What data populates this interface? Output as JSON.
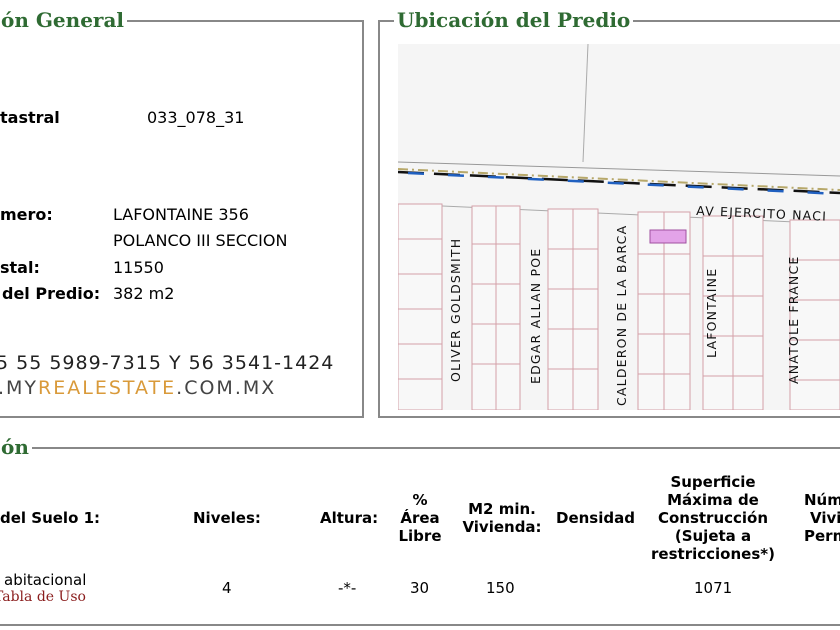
{
  "general": {
    "title": "ón General",
    "cuenta_label": "tastral",
    "cuenta_value": "033_078_31",
    "numero_label": "mero:",
    "direccion_line1": "LAFONTAINE 356",
    "direccion_line2": "POLANCO III SECCION",
    "cp_label": "stal:",
    "cp_value": "11550",
    "superficie_label": "del Predio:",
    "superficie_value": "382 m2",
    "phone_text": "5 55 5989-7315  Y  56 3541-1424",
    "web_prefix": ".MY",
    "web_highlight": "REALESTATE",
    "web_suffix": ".COM.MX"
  },
  "ubicacion": {
    "title": "Ubicación del Predio",
    "streets": {
      "oliver": "OLIVER GOLDSMITH",
      "edgar": "EDGAR ALLAN POE",
      "calderon": "CALDERON DE LA BARCA",
      "lafontaine": "LAFONTAINE",
      "anatole": "ANATOLE FRANCE",
      "ejercito": "AV EJERCITO NACI"
    },
    "parcel_color": "#e3a3e8"
  },
  "zonificacion": {
    "title": "ón",
    "headers": {
      "uso": "del Suelo 1:",
      "niveles": "Niveles:",
      "altura": "Altura:",
      "area_libre": [
        "%",
        "Área",
        "Libre"
      ],
      "m2_min": [
        "M2 min.",
        "Vivienda:"
      ],
      "densidad": "Densidad",
      "superficie_max": [
        "Superficie",
        "Máxima de",
        "Construcción",
        "(Sujeta a",
        "restricciones*)"
      ],
      "num_viv": [
        "Núm",
        "Vivi",
        "Perm"
      ]
    },
    "row": {
      "uso": "abitacional",
      "uso_link": "Tabla de Uso",
      "niveles": "4",
      "altura": "-*-",
      "area_libre": "30",
      "m2_min": "150",
      "densidad": "",
      "superficie_max": "1071"
    }
  }
}
